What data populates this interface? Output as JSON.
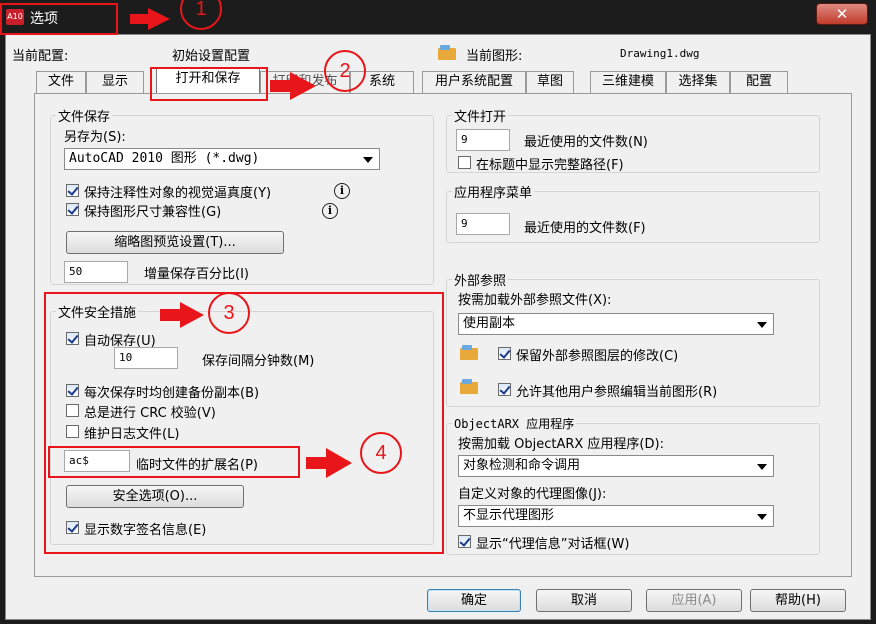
{
  "window": {
    "app_icon": "A10",
    "title": "选项",
    "close": "✕"
  },
  "profile": {
    "label": "当前配置:",
    "value": "初始设置配置",
    "drawing_label": "当前图形:",
    "drawing_value": "Drawing1.dwg"
  },
  "tabs": [
    {
      "label": "文件"
    },
    {
      "label": "显示"
    },
    {
      "label": "打开和保存"
    },
    {
      "label": "打印和发布"
    },
    {
      "label": "系统"
    },
    {
      "label": "用户系统配置"
    },
    {
      "label": "草图"
    },
    {
      "label": "三维建模"
    },
    {
      "label": "选择集"
    },
    {
      "label": "配置"
    }
  ],
  "file_save": {
    "title": "文件保存",
    "save_as_label": "另存为(S):",
    "save_as_value": "AutoCAD 2010 图形 (*.dwg)",
    "check1": "保持注释性对象的视觉逼真度(Y)",
    "check2": "保持图形尺寸兼容性(G)",
    "thumb_button": "缩略图预览设置(T)...",
    "incr_value": "50",
    "incr_label": "增量保存百分比(I)"
  },
  "safety": {
    "title": "文件安全措施",
    "autosave": "自动保存(U)",
    "interval_value": "10",
    "interval_label": "保存间隔分钟数(M)",
    "backup": "每次保存时均创建备份副本(B)",
    "crc": "总是进行 CRC 校验(V)",
    "log": "维护日志文件(L)",
    "ext_value": "ac$",
    "ext_label": "临时文件的扩展名(P)",
    "security_button": "安全选项(O)...",
    "signature": "显示数字签名信息(E)"
  },
  "file_open": {
    "title": "文件打开",
    "recent_value": "9",
    "recent_label": "最近使用的文件数(N)",
    "fullpath": "在标题中显示完整路径(F)"
  },
  "app_menu": {
    "title": "应用程序菜单",
    "recent_value": "9",
    "recent_label": "最近使用的文件数(F)"
  },
  "xref": {
    "title": "外部参照",
    "load_label": "按需加载外部参照文件(X):",
    "load_value": "使用副本",
    "retain": "保留外部参照图层的修改(C)",
    "allow": "允许其他用户参照编辑当前图形(R)"
  },
  "arx": {
    "title": "ObjectARX 应用程序",
    "load_label": "按需加载 ObjectARX 应用程序(D):",
    "load_value": "对象检测和命令调用",
    "proxy_label": "自定义对象的代理图像(J):",
    "proxy_value": "不显示代理图形",
    "proxy_dialog": "显示“代理信息”对话框(W)"
  },
  "footer": {
    "ok": "确定",
    "cancel": "取消",
    "apply": "应用(A)",
    "help": "帮助(H)"
  },
  "annotations": {
    "c1": "1",
    "c2": "2",
    "c3": "3",
    "c4": "4"
  },
  "colors": {
    "accent": "#e8161a",
    "titlebar": "#1c1c1c",
    "panel": "#f0f0f0"
  }
}
